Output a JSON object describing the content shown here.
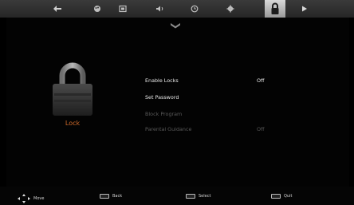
{
  "tabs": [
    {
      "icon": "picture-icon"
    },
    {
      "icon": "sound-palette-icon"
    },
    {
      "icon": "channel-icon"
    },
    {
      "icon": "volume-icon"
    },
    {
      "icon": "clock-icon"
    },
    {
      "icon": "settings-gear-icon"
    },
    {
      "icon": "lock-icon",
      "active": true
    },
    {
      "icon": "forward-icon"
    }
  ],
  "section": {
    "title": "Lock"
  },
  "menu": [
    {
      "label": "Enable Locks",
      "value": "Off",
      "enabled": true
    },
    {
      "label": "Set Password",
      "value": "",
      "enabled": true
    },
    {
      "label": "Block Program",
      "value": "",
      "enabled": false
    },
    {
      "label": "Parental Guidance",
      "value": "Off",
      "enabled": false
    }
  ],
  "footer": [
    {
      "icon": "dpad-icon",
      "label": "Move"
    },
    {
      "icon": "menu-key-icon",
      "label": "Back"
    },
    {
      "icon": "select-key-icon",
      "label": "Select"
    },
    {
      "icon": "exit-key-icon",
      "label": "Quit"
    }
  ],
  "colors": {
    "accent": "#d06a2a",
    "text": "#eaeaea",
    "disabled": "#5a5a5a",
    "tab_active": "#c8c8c8"
  }
}
